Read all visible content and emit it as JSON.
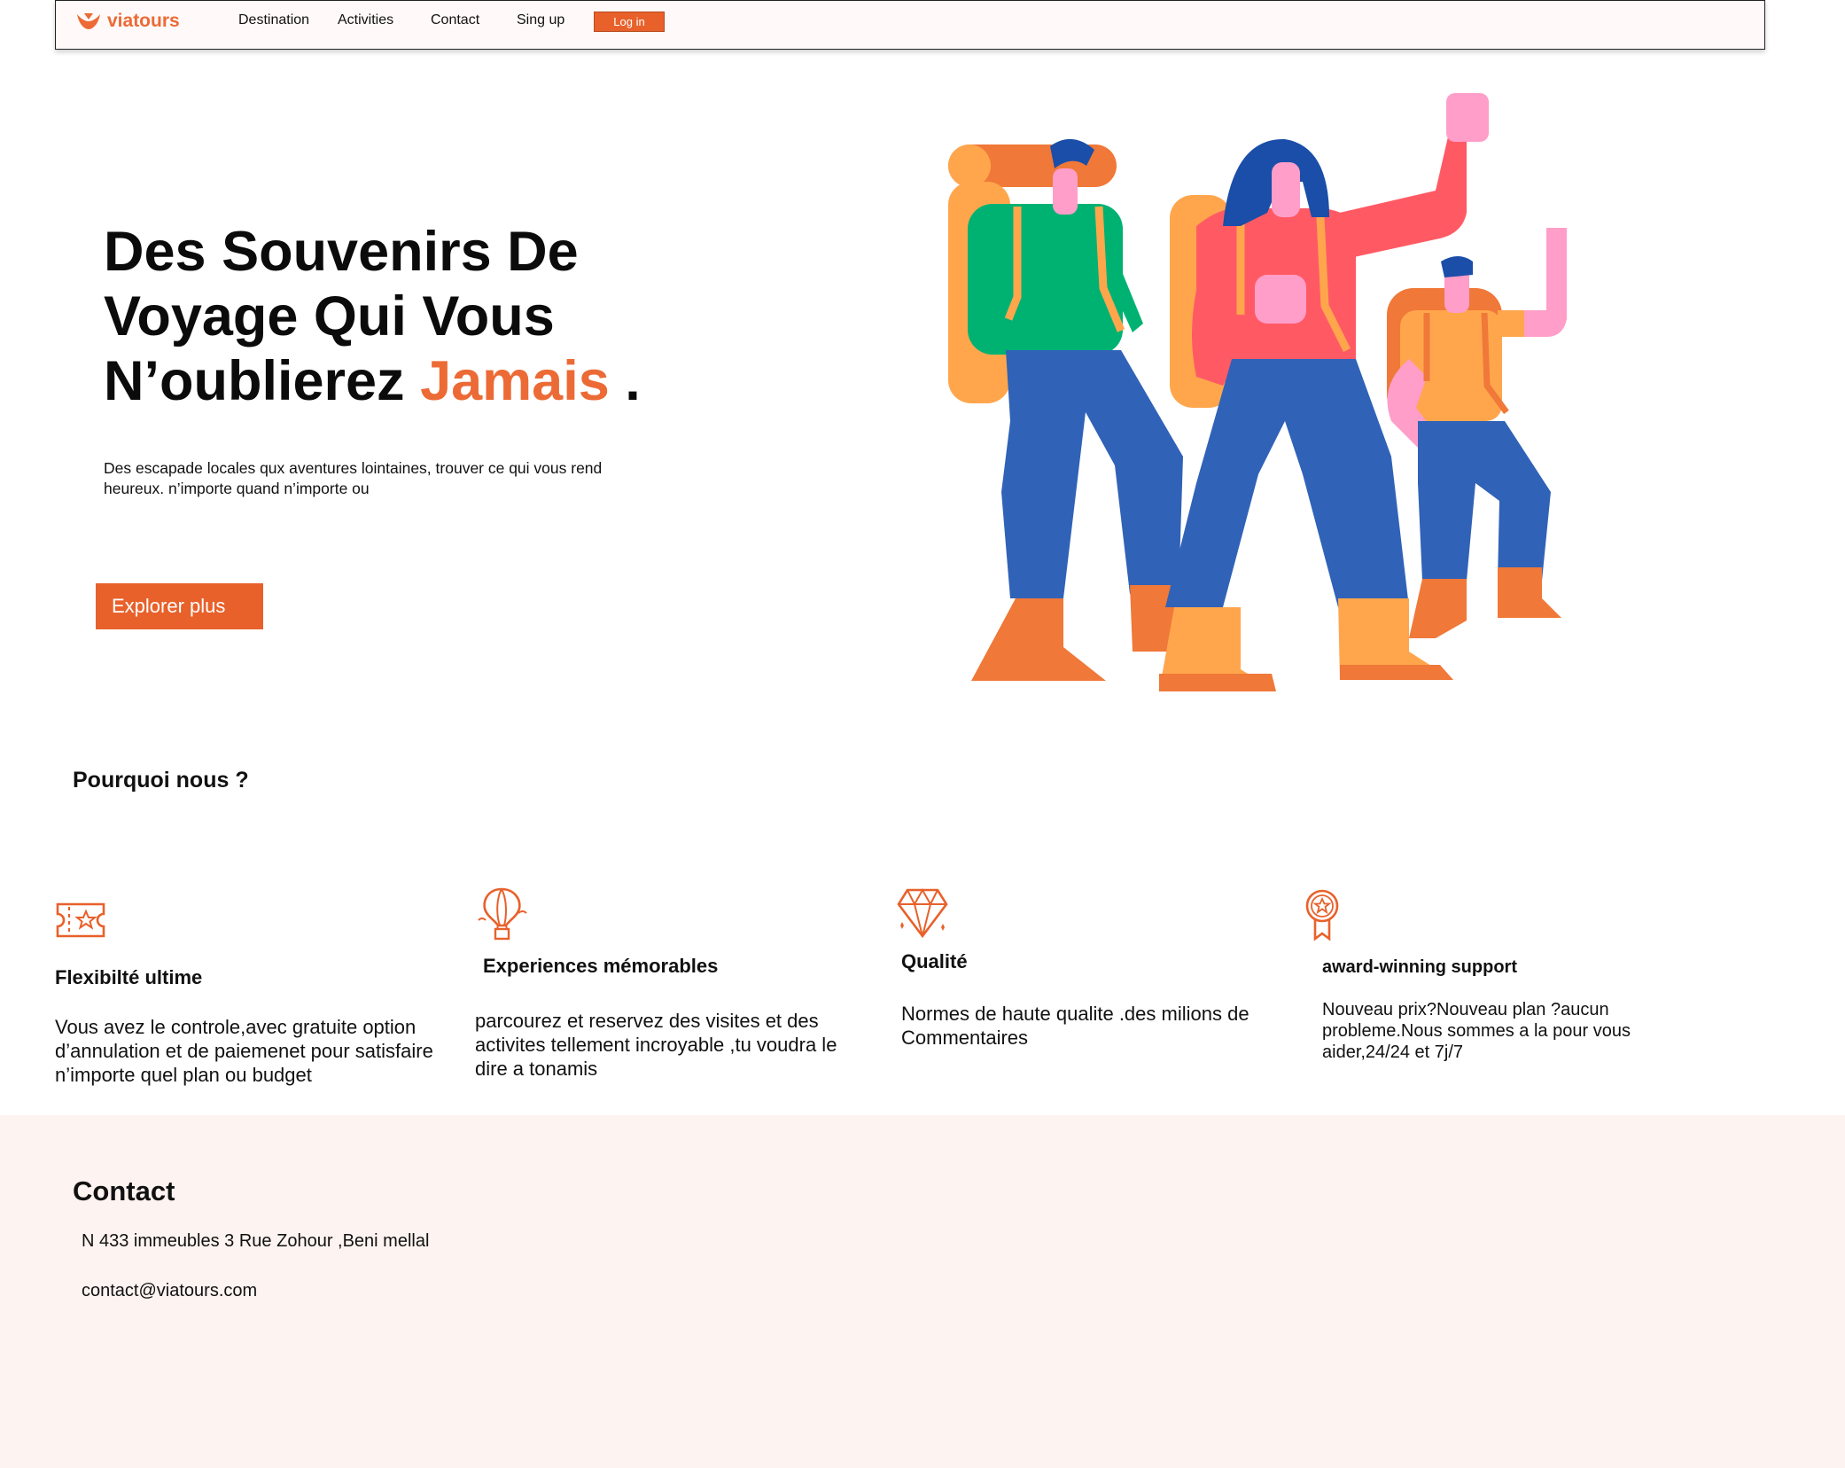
{
  "nav": {
    "logo_text": "viatours",
    "links": [
      "Destination",
      "Activities",
      "Contact",
      "Sing up"
    ],
    "login_label": "Log in"
  },
  "hero": {
    "title_part1": "Des Souvenirs De Voyage Qui Vous N’oublierez",
    "title_accent": "Jamais",
    "title_end": ".",
    "subtitle": "Des escapade locales qux aventures lointaines, trouver ce qui vous rend heureux. n’importe quand n’importe ou",
    "cta_label": "Explorer plus"
  },
  "why": {
    "title": "Pourquoi nous ?",
    "features": [
      {
        "icon": "ticket-icon",
        "title": "Flexibilté ultime",
        "text": "Vous avez le controle,avec gratuite option d’annulation et de paiemenet pour satisfaire n’importe quel plan ou budget"
      },
      {
        "icon": "hot-air-balloon-icon",
        "title": "Experiences mémorables",
        "text": "parcourez et reservez des visites et des activites tellement incroyable ,tu voudra le dire a tonamis"
      },
      {
        "icon": "diamond-icon",
        "title": "Qualité",
        "text": "Normes de haute qualite .des milions de Commentaires"
      },
      {
        "icon": "award-icon",
        "title": "award-winning support",
        "text": "Nouveau prix?Nouveau plan ?aucun probleme.Nous sommes a la pour vous aider,24/24 et 7j/7"
      }
    ]
  },
  "contact": {
    "title": "Contact",
    "address": "N 433 immeubles 3 Rue Zohour ,Beni mellal",
    "email": "contact@viatours.com"
  },
  "colors": {
    "accent": "#ec6a35",
    "button": "#e8612b",
    "footer_bg": "#fdf3f0"
  }
}
